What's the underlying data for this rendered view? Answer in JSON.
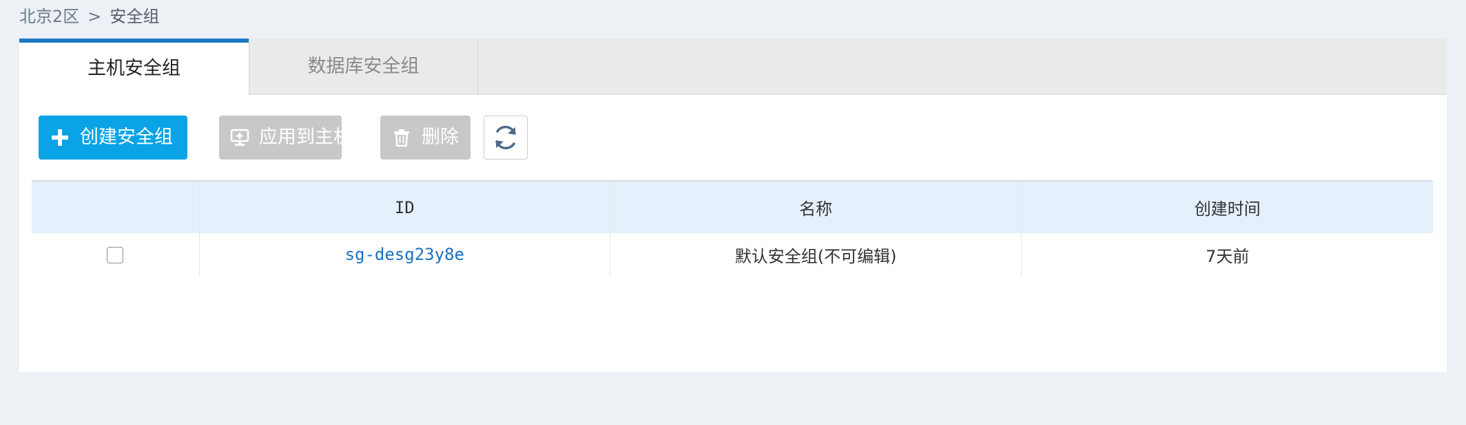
{
  "breadcrumb": {
    "region": "北京2区",
    "separator": ">",
    "current": "安全组"
  },
  "tabs": [
    {
      "label": "主机安全组",
      "active": true
    },
    {
      "label": "数据库安全组",
      "active": false
    }
  ],
  "toolbar": {
    "create_label": "创建安全组",
    "apply_label": "应用到主机",
    "delete_label": "删除",
    "create_icon": "plus-icon",
    "apply_icon": "monitor-icon",
    "delete_icon": "trash-icon",
    "refresh_icon": "refresh-icon"
  },
  "table": {
    "headers": [
      "ID",
      "名称",
      "创建时间"
    ],
    "rows": [
      {
        "id": "sg-desg23y8e",
        "name": "默认安全组(不可编辑)",
        "created": "7天前",
        "checked": false
      }
    ]
  },
  "colors": {
    "primary": "#0aa3e6",
    "tab_accent": "#1979c5",
    "disabled": "#c8c8c8",
    "link": "#1a6fbf",
    "header_bg": "#e4f1fc",
    "page_bg": "#edf0f5"
  }
}
